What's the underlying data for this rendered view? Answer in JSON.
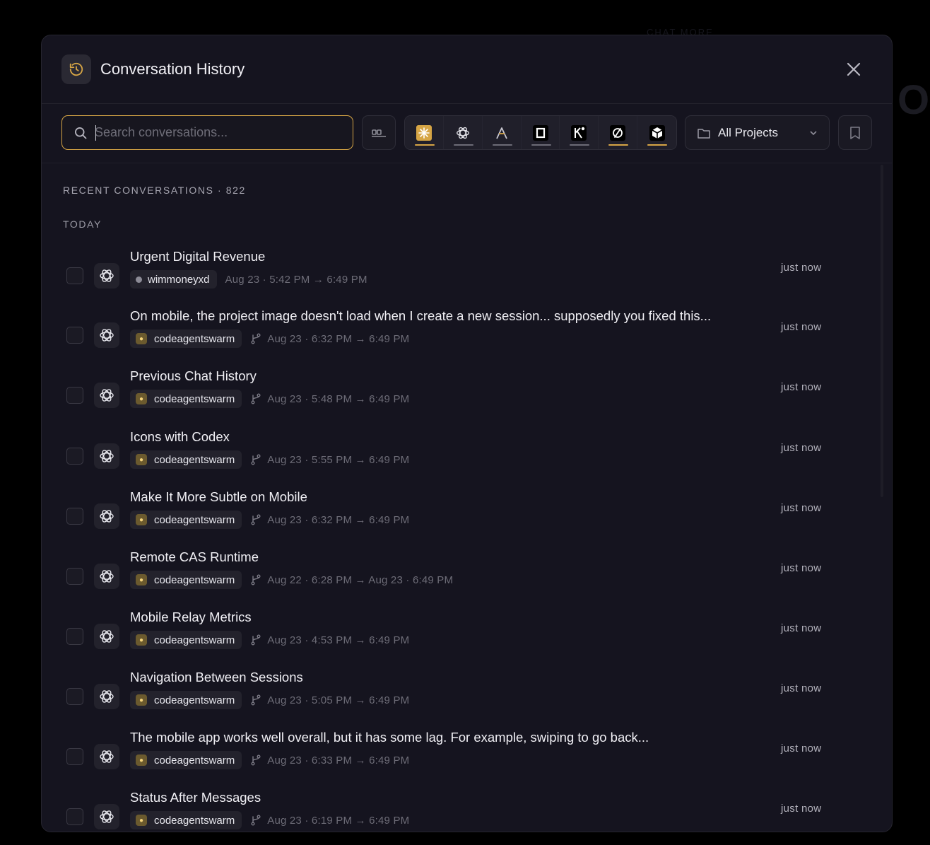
{
  "backdrop": {
    "faint_label": "CHAT MORE",
    "faint_letter": "O"
  },
  "header": {
    "title": "Conversation History"
  },
  "search": {
    "placeholder": "Search conversations..."
  },
  "filters": {
    "providers": [
      {
        "name": "claude",
        "active": true
      },
      {
        "name": "openai",
        "active": false
      },
      {
        "name": "amp",
        "active": false
      },
      {
        "name": "opencode",
        "active": false
      },
      {
        "name": "kimi",
        "active": false
      },
      {
        "name": "cursor",
        "active": true
      },
      {
        "name": "sourcegraph",
        "active": true
      }
    ],
    "projects_label": "All Projects"
  },
  "list": {
    "section_title": "RECENT CONVERSATIONS · 822",
    "day_label": "TODAY",
    "items": [
      {
        "title": "Urgent Digital Revenue",
        "project": "wimmoneyxd",
        "project_kind": "dot",
        "branch": false,
        "range": "Aug 23 · 5:42 PM → 6:49 PM",
        "relative": "just now"
      },
      {
        "title": "On mobile, the project image doesn't load when I create a new session... supposedly you fixed this...",
        "project": "codeagentswarm",
        "project_kind": "icon",
        "branch": true,
        "range": "Aug 23 · 6:32 PM → 6:49 PM",
        "relative": "just now"
      },
      {
        "title": "Previous Chat History",
        "project": "codeagentswarm",
        "project_kind": "icon",
        "branch": true,
        "range": "Aug 23 · 5:48 PM → 6:49 PM",
        "relative": "just now"
      },
      {
        "title": "Icons with Codex",
        "project": "codeagentswarm",
        "project_kind": "icon",
        "branch": true,
        "range": "Aug 23 · 5:55 PM → 6:49 PM",
        "relative": "just now"
      },
      {
        "title": "Make It More Subtle on Mobile",
        "project": "codeagentswarm",
        "project_kind": "icon",
        "branch": true,
        "range": "Aug 23 · 6:32 PM → 6:49 PM",
        "relative": "just now"
      },
      {
        "title": "Remote CAS Runtime",
        "project": "codeagentswarm",
        "project_kind": "icon",
        "branch": true,
        "range": "Aug 22 · 6:28 PM → Aug 23 · 6:49 PM",
        "relative": "just now"
      },
      {
        "title": "Mobile Relay Metrics",
        "project": "codeagentswarm",
        "project_kind": "icon",
        "branch": true,
        "range": "Aug 23 · 4:53 PM → 6:49 PM",
        "relative": "just now"
      },
      {
        "title": "Navigation Between Sessions",
        "project": "codeagentswarm",
        "project_kind": "icon",
        "branch": true,
        "range": "Aug 23 · 5:05 PM → 6:49 PM",
        "relative": "just now"
      },
      {
        "title": "The mobile app works well overall, but it has some lag. For example, swiping to go back...",
        "project": "codeagentswarm",
        "project_kind": "icon",
        "branch": true,
        "range": "Aug 23 · 6:33 PM → 6:49 PM",
        "relative": "just now"
      },
      {
        "title": "Status After Messages",
        "project": "codeagentswarm",
        "project_kind": "icon",
        "branch": true,
        "range": "Aug 23 · 6:19 PM → 6:49 PM",
        "relative": "just now"
      }
    ]
  },
  "colors": {
    "accent": "#d6a545",
    "panel": "#15141f",
    "background": "#000000"
  }
}
